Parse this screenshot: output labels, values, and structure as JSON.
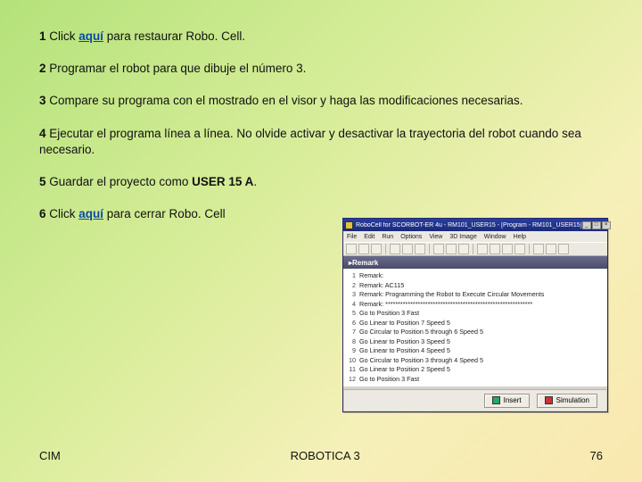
{
  "steps": [
    {
      "num": "1",
      "pre": " Click ",
      "link": "aquí",
      "post": " para restaurar Robo. Cell."
    },
    {
      "num": "2",
      "text": " Programar el robot para que dibuje el número 3."
    },
    {
      "num": "3",
      "text": " Compare su programa con el mostrado en el visor y haga las modificaciones necesarias."
    },
    {
      "num": "4",
      "text": " Ejecutar el programa línea a línea. No olvide activar y desactivar la trayectoria del robot cuando sea necesario."
    },
    {
      "num": "5",
      "pre": " Guardar el proyecto como ",
      "bold": "USER 15 A",
      "post": "."
    },
    {
      "num": "6",
      "pre": " Click ",
      "link": "aquí",
      "post": " para cerrar Robo. Cell"
    }
  ],
  "footer": {
    "left": "CIM",
    "center": "ROBOTICA 3",
    "right": "76"
  },
  "app": {
    "title": "RoboCell for SCORBOT-ER 4u - RM101_USER15 - [Program - RM101_USER15]",
    "menus": [
      "File",
      "Edit",
      "Run",
      "Options",
      "View",
      "3D Image",
      "Window",
      "Help"
    ],
    "section": "Remark",
    "lines": [
      "Remark:",
      "Remark: AC115",
      "Remark: Programming the Robot to Execute Circular Movements",
      "Remark: ***********************************************************",
      "Go to Position 3 Fast",
      "Go Linear to Position 7 Speed 5",
      "Go Circular to Position 5 through 6 Speed 5",
      "Go Linear to Position 3 Speed 5",
      "Go Linear to Position 4 Speed 5",
      "Go Circular to Position 3 through 4 Speed 5",
      "Go Linear to Position 2 Speed 5",
      "Go to Position 3 Fast"
    ],
    "buttons": {
      "insert": "Insert",
      "simulation": "Simulation"
    }
  }
}
